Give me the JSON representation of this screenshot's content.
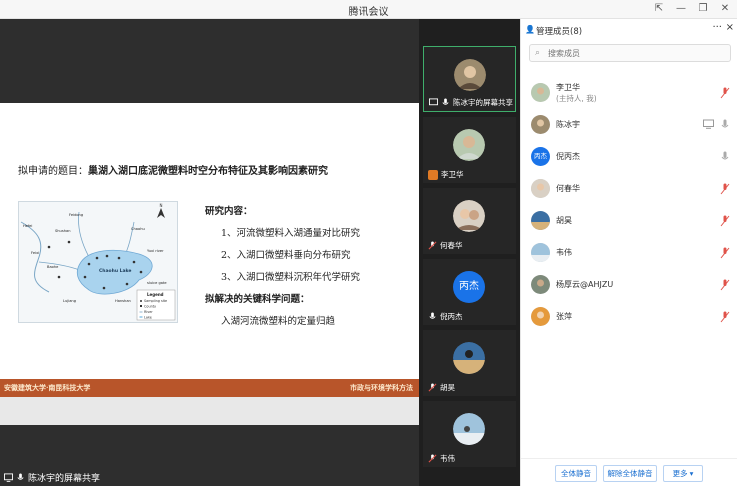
{
  "window": {
    "title": "腾讯会议",
    "controls": [
      "pin-icon",
      "minimize-icon",
      "maximize-icon",
      "close-icon"
    ]
  },
  "slide": {
    "title_prefix": "拟申请的题目：",
    "title_main": "巢湖入湖口底泥微塑料时空分布特征及其影响因素研究",
    "section1": "研究内容：",
    "items": [
      "1、河流微塑料入湖通量对比研究",
      "2、入湖口微塑料垂向分布研究",
      "3、入湖口微塑料沉积年代学研究"
    ],
    "section2": "拟解决的关键科学问题：",
    "key_problem": "入湖河流微塑料的定量归趋",
    "footer_left": "安徽建筑大学·南昆科技大学",
    "footer_right": "市政与环境学科方法",
    "map": {
      "lake_label": "Chaohu Lake",
      "legend_title": "Legend",
      "legend_items": [
        "Sampling site",
        "County",
        "River",
        "Lake"
      ],
      "place_labels": [
        "Hefei",
        "Feidong",
        "Feixi",
        "Shushan",
        "Baohe",
        "Chaohu",
        "Lujiang",
        "Hanshan",
        "Yuxi river",
        "sluice gate"
      ]
    }
  },
  "sharer": {
    "label": "陈冰宇的屏幕共享"
  },
  "video_tiles": [
    {
      "name": "陈冰宇的屏幕共享",
      "active": true
    },
    {
      "name": "李卫华",
      "host": true
    },
    {
      "name": "何春华"
    },
    {
      "name": "倪丙杰",
      "avatar_text": "丙杰"
    },
    {
      "name": "胡昊"
    },
    {
      "name": "韦伟"
    }
  ],
  "panel": {
    "title": "管理成员(8)",
    "more": "···",
    "close": "×",
    "search_placeholder": "搜索成员",
    "members": [
      {
        "name": "李卫华",
        "sub": "(主持人, 我)",
        "mic": "muted"
      },
      {
        "name": "陈冰宇",
        "mic": "on",
        "camera": true
      },
      {
        "name": "倪丙杰",
        "avatar_text": "丙杰",
        "mic": "on"
      },
      {
        "name": "何春华",
        "mic": "muted"
      },
      {
        "name": "胡昊",
        "mic": "muted"
      },
      {
        "name": "韦伟",
        "mic": "muted"
      },
      {
        "name": "杨厚云@AHJZU",
        "mic": "muted"
      },
      {
        "name": "张萍",
        "mic": "muted"
      }
    ],
    "buttons": {
      "mute_all": "全体静音",
      "unmute_all": "解除全体静音",
      "more": "更多 ▾"
    }
  },
  "colors": {
    "accent": "#1a6fd0",
    "muted_mic": "#e0534a",
    "footer_band": "#b8552a",
    "active_tile": "#3fae6b"
  }
}
